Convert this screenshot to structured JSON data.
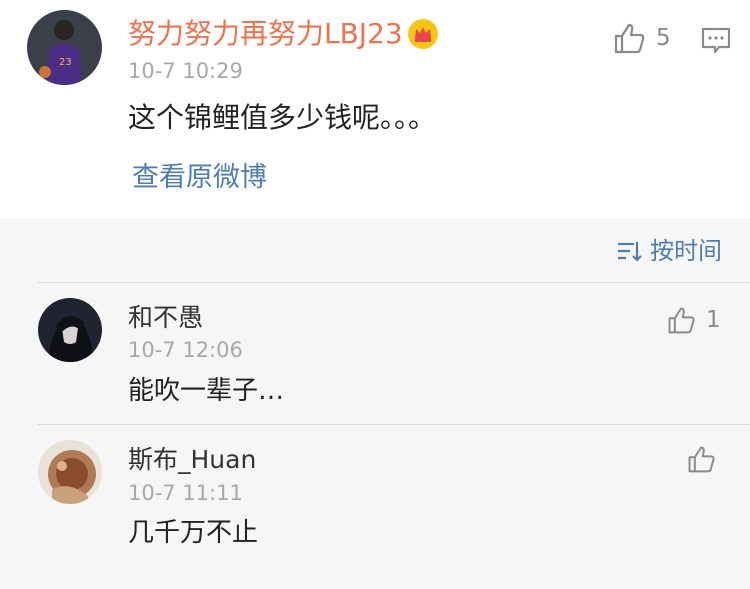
{
  "main_comment": {
    "username": "努力努力再努力LBJ23",
    "timestamp": "10-7 10:29",
    "text": "这个锦鲤值多少钱呢。。。",
    "like_count": "5",
    "view_original_label": "查看原微博",
    "badge_icon": "crown-icon",
    "name_color": "#eb7350"
  },
  "sort": {
    "label": "按时间",
    "icon": "sort-icon"
  },
  "replies": [
    {
      "username": "和不愚",
      "timestamp": "10-7 12:06",
      "text": "能吹一辈子…",
      "like_count": "1"
    },
    {
      "username": "斯布_Huan",
      "timestamp": "10-7 11:11",
      "text": "几千万不止",
      "like_count": ""
    }
  ],
  "colors": {
    "link": "#507daf",
    "accent": "#eb7350",
    "muted": "#a8a8a8"
  }
}
